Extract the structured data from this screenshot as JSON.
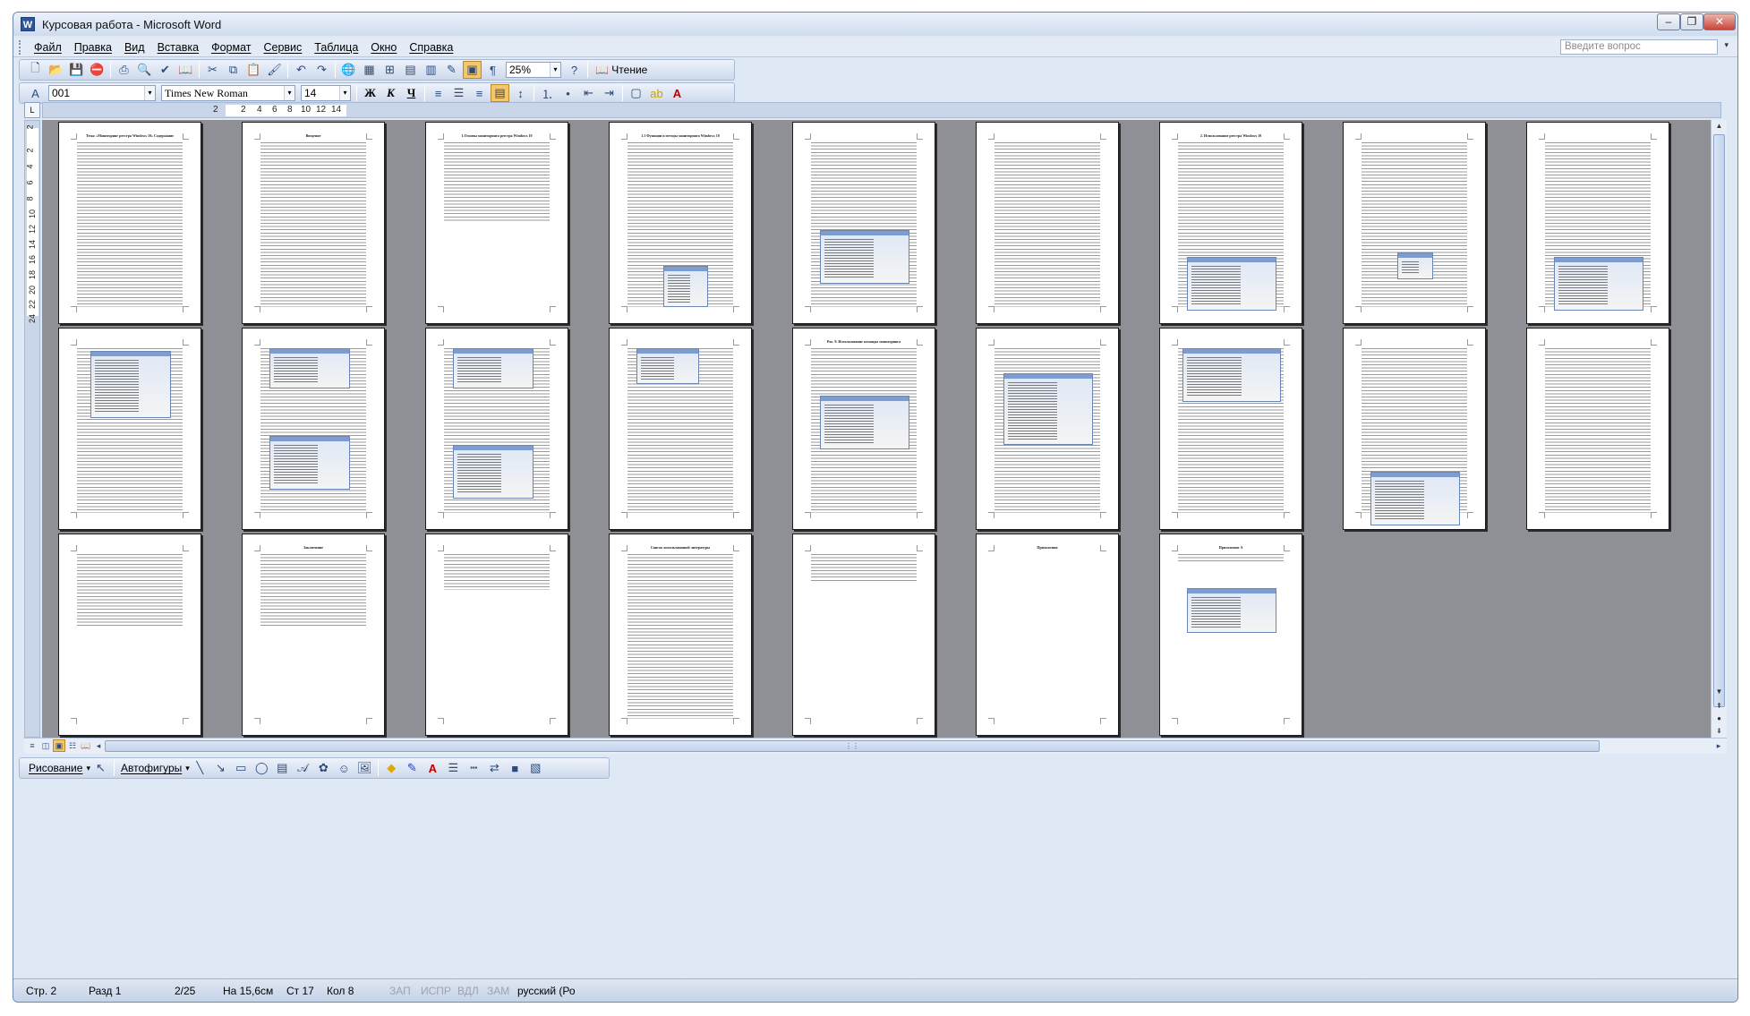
{
  "window": {
    "title": "Курсовая работа - Microsoft Word",
    "app_icon": "W"
  },
  "caption_buttons": {
    "minimize": "–",
    "restore": "❐",
    "close": "✕"
  },
  "menu": [
    "Файл",
    "Правка",
    "Вид",
    "Вставка",
    "Формат",
    "Сервис",
    "Таблица",
    "Окно",
    "Справка"
  ],
  "help_box": {
    "placeholder": "Введите вопрос"
  },
  "standard_toolbar": {
    "zoom": "25%",
    "reading_label": "Чтение"
  },
  "formatting_toolbar": {
    "style": "001",
    "font": "Times New Roman",
    "size": "14",
    "bold": "Ж",
    "italic": "К",
    "underline": "Ч"
  },
  "ruler_numbers": [
    "2",
    "2",
    "4",
    "6",
    "8",
    "10",
    "12",
    "14"
  ],
  "vruler_numbers": [
    "2",
    "2",
    "4",
    "6",
    "8",
    "10",
    "12",
    "14",
    "16",
    "18",
    "20",
    "22",
    "24"
  ],
  "pages": [
    {
      "title": "Тема: «Мониторинг реестра Windows 10»\nСодержание"
    },
    {
      "title": "Введение"
    },
    {
      "title": "1.Основы мониторинга реестра Windows 10"
    },
    {
      "title": "1.1 Функции и методы мониторинга Windows 10"
    },
    {
      "title": ""
    },
    {
      "title": ""
    },
    {
      "title": "2. Использование реестра Windows 10"
    },
    {
      "title": ""
    },
    {
      "title": ""
    },
    {
      "title": ""
    },
    {
      "title": ""
    },
    {
      "title": ""
    },
    {
      "title": ""
    },
    {
      "title": "Рис. 9. Использование команды мониторинга"
    },
    {
      "title": ""
    },
    {
      "title": ""
    },
    {
      "title": ""
    },
    {
      "title": ""
    },
    {
      "title": ""
    },
    {
      "title": "Заключение"
    },
    {
      "title": ""
    },
    {
      "title": "Список использованной литературы"
    },
    {
      "title": ""
    },
    {
      "title": "Приложения"
    },
    {
      "title": "Приложение А"
    }
  ],
  "draw_toolbar": {
    "draw_label": "Рисование",
    "autoshapes_label": "Автофигуры"
  },
  "status": {
    "page": "Стр. 2",
    "section": "Разд 1",
    "pages": "2/25",
    "at": "На 15,6см",
    "line": "Ст 17",
    "col": "Кол 8",
    "rec": "ЗАП",
    "trk": "ИСПР",
    "ext": "ВДЛ",
    "ovr": "ЗАМ",
    "lang": "русский (Ро"
  }
}
